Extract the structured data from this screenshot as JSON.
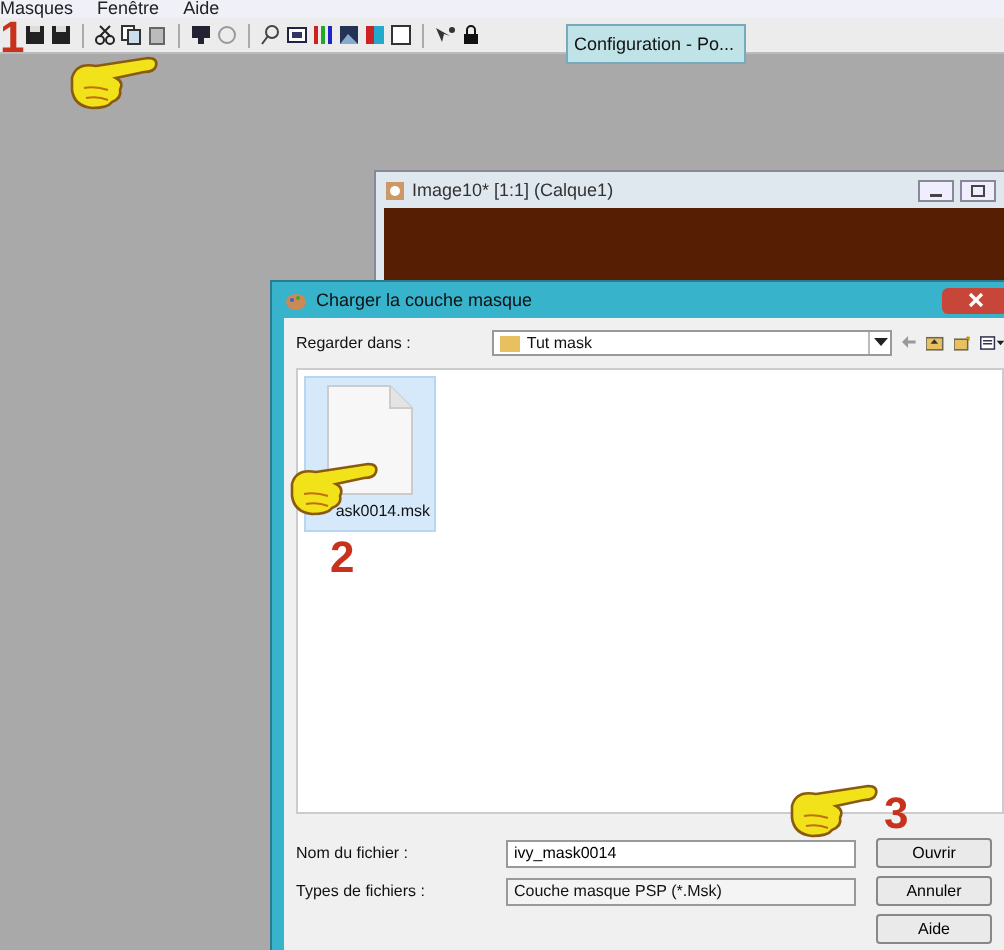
{
  "menu_bar": {
    "items": [
      "Masques",
      "Fenêtre",
      "Aide"
    ]
  },
  "palette": {
    "title": "Configuration - Po..."
  },
  "image_window": {
    "title": "Image10* [1:1] (Calque1)"
  },
  "dialog": {
    "title": "Charger la couche masque",
    "look_in": {
      "label": "Regarder dans :",
      "value": "Tut mask"
    },
    "files": [
      {
        "name": "ask0014.msk",
        "selected": true
      }
    ],
    "file_name": {
      "label": "Nom du fichier :",
      "value": "ivy_mask0014"
    },
    "file_type": {
      "label": "Types de fichiers :",
      "value": "Couche masque PSP (*.Msk)"
    },
    "buttons": [
      "Ouvrir",
      "Annuler",
      "Aide"
    ]
  },
  "annotations": [
    "1",
    "2",
    "3"
  ]
}
